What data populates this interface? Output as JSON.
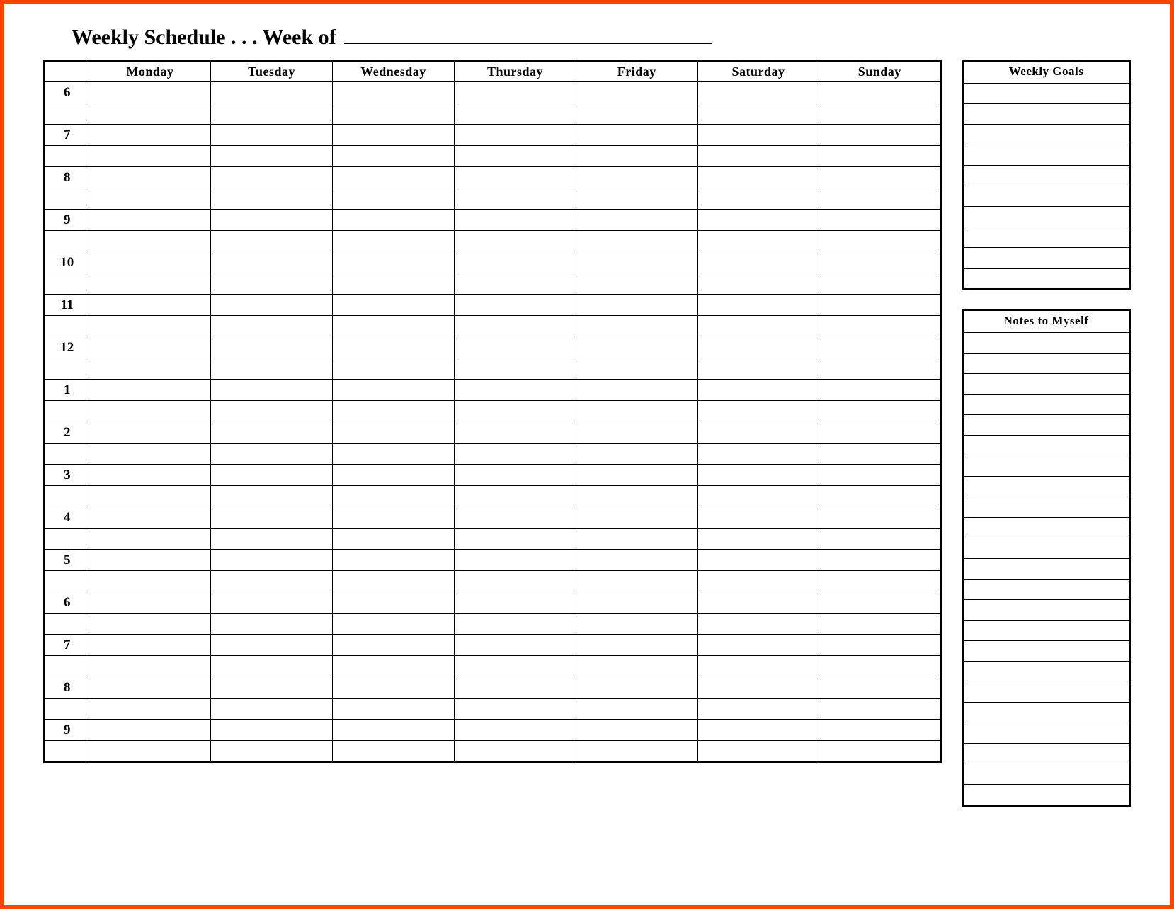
{
  "title": {
    "prefix": "Weekly Schedule . . . Week of ",
    "blank_value": ""
  },
  "schedule": {
    "days": [
      "Monday",
      "Tuesday",
      "Wednesday",
      "Thursday",
      "Friday",
      "Saturday",
      "Sunday"
    ],
    "hours": [
      "6",
      "7",
      "8",
      "9",
      "10",
      "11",
      "12",
      "1",
      "2",
      "3",
      "4",
      "5",
      "6",
      "7",
      "8",
      "9"
    ],
    "rows_per_hour": 2
  },
  "sidebar": {
    "goals": {
      "title": "Weekly Goals",
      "line_count": 10
    },
    "notes": {
      "title": "Notes to Myself",
      "line_count": 23
    }
  }
}
